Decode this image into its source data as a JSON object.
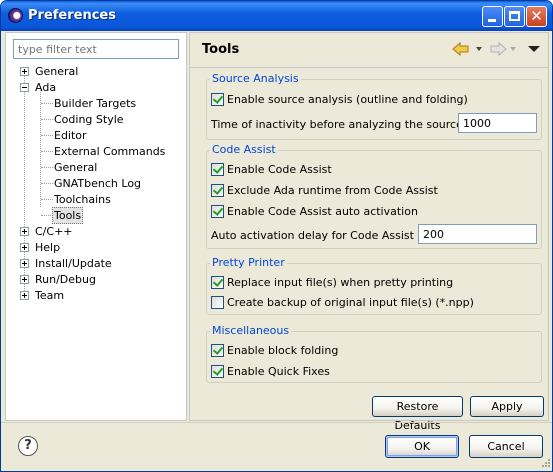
{
  "window": {
    "title": "Preferences"
  },
  "filter": {
    "placeholder": "type filter text"
  },
  "tree": {
    "general": "General",
    "ada": "Ada",
    "ada_children": [
      "Builder Targets",
      "Coding Style",
      "Editor",
      "External Commands",
      "General",
      "GNATbench Log",
      "Toolchains",
      "Tools"
    ],
    "selected": "Tools",
    "others": [
      "C/C++",
      "Help",
      "Install/Update",
      "Run/Debug",
      "Team"
    ]
  },
  "page": {
    "title": "Tools"
  },
  "source_analysis": {
    "title": "Source Analysis",
    "enable_label": "Enable source analysis (outline and folding)",
    "enable_checked": true,
    "inactivity_label": "Time of inactivity before analyzing the source (ms)",
    "inactivity_value": "1000"
  },
  "code_assist": {
    "title": "Code Assist",
    "enable_label": "Enable Code Assist",
    "enable_checked": true,
    "exclude_label": "Exclude Ada runtime from Code Assist",
    "exclude_checked": true,
    "auto_label": "Enable Code Assist auto activation",
    "auto_checked": true,
    "delay_label": "Auto activation delay for Code Assist (ms)",
    "delay_value": "200"
  },
  "pretty_printer": {
    "title": "Pretty Printer",
    "replace_label": "Replace input file(s) when pretty printing",
    "replace_checked": true,
    "backup_label": "Create backup of original input file(s) (*.npp)",
    "backup_checked": false
  },
  "misc": {
    "title": "Miscellaneous",
    "folding_label": "Enable block folding",
    "folding_checked": true,
    "quickfix_label": "Enable Quick Fixes",
    "quickfix_checked": true
  },
  "buttons": {
    "restore_defaults": "Restore Defaults",
    "apply": "Apply",
    "ok": "OK",
    "cancel": "Cancel"
  },
  "help": {
    "glyph": "?"
  },
  "colors": {
    "titlebar": "#0a55d8",
    "group_title": "#0046d5",
    "check": "#21a121"
  }
}
